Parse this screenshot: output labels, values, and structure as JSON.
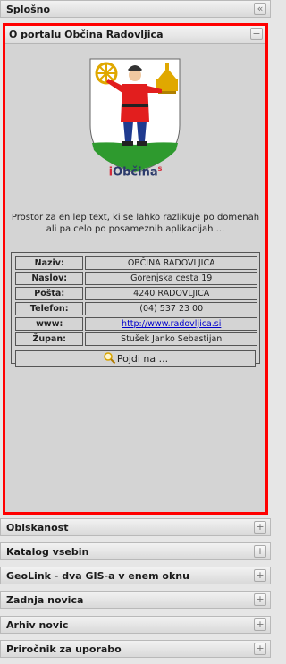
{
  "panels": {
    "splosno": "Splošno",
    "about": "O portalu Občina Radovljica",
    "obiskanost": "Obiskanost",
    "katalog": "Katalog vsebin",
    "geolink": "GeoLink - dva GIS-a v enem oknu",
    "zadnja": "Zadnja novica",
    "arhiv": "Arhiv novic",
    "prirocnik": "Priročnik za uporabo"
  },
  "buttons": {
    "collapse_all": "«",
    "minus": "−",
    "plus": "+"
  },
  "logo": {
    "prefix": "i",
    "name": "Občina",
    "suffix": "s"
  },
  "description": "Prostor za en lep text, ki se lahko razlikuje po domenah ali pa celo po posameznih aplikacijah ...",
  "info": [
    {
      "label": "Naziv:",
      "value": "OBČINA RADOVLJICA"
    },
    {
      "label": "Naslov:",
      "value": "Gorenjska cesta 19"
    },
    {
      "label": "Pošta:",
      "value": "4240 RADOVLJICA"
    },
    {
      "label": "Telefon:",
      "value": "(04) 537 23 00"
    },
    {
      "label": "www:",
      "value": "http://www.radovljica.si"
    },
    {
      "label": "Župan:",
      "value": "Stušek Janko Sebastijan"
    }
  ],
  "find_button": "Pojdi na ...",
  "colors": {
    "highlight": "#ff0000",
    "link": "#0000cc",
    "logo_red": "#d32a3a",
    "logo_navy": "#2b3a6b"
  }
}
